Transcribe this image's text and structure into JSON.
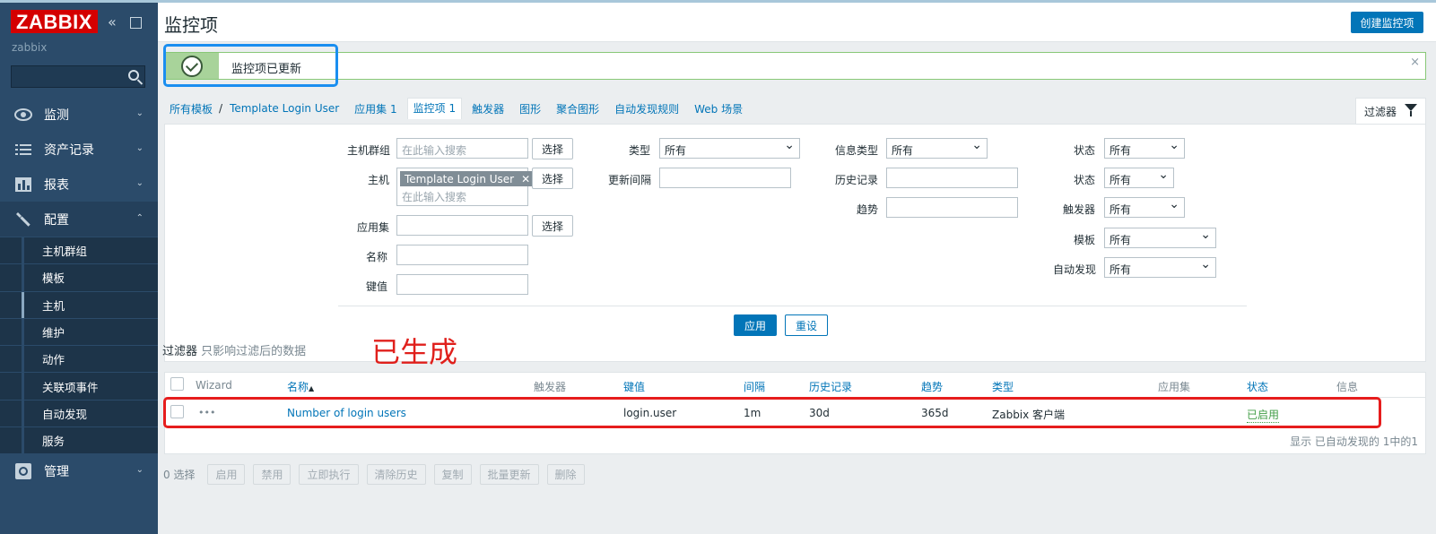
{
  "app": {
    "logo": "ZABBIX",
    "server_name": "zabbix"
  },
  "sidebar": {
    "menu": [
      {
        "label": "监测",
        "icon": "eye-icon"
      },
      {
        "label": "资产记录",
        "icon": "list-icon"
      },
      {
        "label": "报表",
        "icon": "bar-chart-icon"
      },
      {
        "label": "配置",
        "icon": "wrench-icon"
      },
      {
        "label": "管理",
        "icon": "gear-icon"
      }
    ],
    "config_submenu": [
      "主机群组",
      "模板",
      "主机",
      "维护",
      "动作",
      "关联项事件",
      "自动发现",
      "服务"
    ],
    "selected_submenu": "主机"
  },
  "header": {
    "title": "监控项",
    "create_button": "创建监控项"
  },
  "message": {
    "text": "监控项已更新",
    "close": "×"
  },
  "nav": {
    "all_templates": "所有模板",
    "separator": "/",
    "template": "Template Login User",
    "tabs": [
      "应用集 1",
      "监控项 1",
      "触发器",
      "图形",
      "聚合图形",
      "自动发现规则",
      "Web 场景"
    ],
    "filter_tab": "过滤器"
  },
  "filter": {
    "host_group_label": "主机群组",
    "host_label": "主机",
    "app_label": "应用集",
    "name_label": "名称",
    "key_label": "键值",
    "search_placeholder": "在此输入搜索",
    "select_button": "选择",
    "host_tag": "Template Login User",
    "type_label": "类型",
    "type_value": "所有",
    "interval_label": "更新间隔",
    "info_type_label": "信息类型",
    "info_type_value": "所有",
    "history_label": "历史记录",
    "trend_label": "趋势",
    "state_label": "状态",
    "state_value": "所有",
    "status_label": "状态",
    "status_value": "所有",
    "triggers_label": "触发器",
    "triggers_value": "所有",
    "template_label": "模板",
    "template_value": "所有",
    "discovery_label": "自动发现",
    "discovery_value": "所有",
    "apply": "应用",
    "reset": "重设",
    "note_title": "过滤器",
    "note_text": "只影响过滤后的数据"
  },
  "annotation": "已生成",
  "table": {
    "headers": {
      "wizard": "Wizard",
      "name": "名称",
      "sort_arrow": "▲",
      "triggers": "触发器",
      "key": "键值",
      "interval": "间隔",
      "history": "历史记录",
      "trends": "趋势",
      "type": "类型",
      "applications": "应用集",
      "status": "状态",
      "info": "信息"
    },
    "rows": [
      {
        "wizard": "•••",
        "name": "Number of login users",
        "key": "login.user",
        "interval": "1m",
        "history": "30d",
        "trends": "365d",
        "type": "Zabbix 客户端",
        "status": "已启用"
      }
    ],
    "footer": "显示 已自动发现的 1中的1"
  },
  "bulk": {
    "selected": "0 选择",
    "buttons": [
      "启用",
      "禁用",
      "立即执行",
      "清除历史",
      "复制",
      "批量更新",
      "删除"
    ]
  },
  "colors": {
    "accent": "#0275b8",
    "sidebar": "#2b4b6a",
    "logo": "#d40000",
    "success": "#429e47",
    "highlight_red": "#e61d1d",
    "highlight_blue": "#1a8ef0"
  }
}
